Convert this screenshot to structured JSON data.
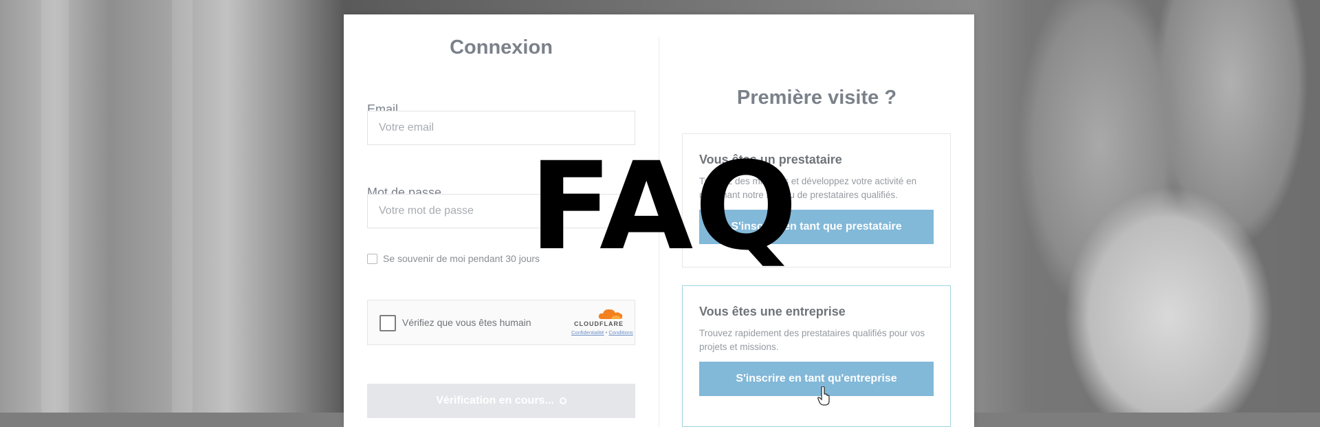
{
  "login": {
    "title": "Connexion",
    "email_label": "Email",
    "email_placeholder": "Votre email",
    "password_label": "Mot de passe",
    "password_placeholder": "Votre mot de passe",
    "remember_label": "Se souvenir de moi pendant 30 jours",
    "captcha": {
      "label": "Vérifiez que vous êtes humain",
      "brand": "CLOUDFLARE",
      "privacy_link": "Confidentialité",
      "separator": "•",
      "terms_link": "Conditions"
    },
    "submit_label": "Vérification en cours..."
  },
  "signup": {
    "title": "Première visite ?",
    "provider": {
      "title": "Vous êtes un prestataire",
      "text": "Trouvez des missions et développez votre activité en rejoignant notre réseau de prestataires qualifiés.",
      "button": "S'inscrire en tant que prestataire"
    },
    "company": {
      "title": "Vous êtes une entreprise",
      "text": "Trouvez rapidement des prestataires qualifiés pour vos projets et missions.",
      "button": "S'inscrire en tant qu'entreprise"
    }
  },
  "overlay": {
    "text": "FAQ"
  },
  "colors": {
    "primary_button": "#82b8d8",
    "disabled_button": "#e4e6ea",
    "title_text": "#7b818a",
    "active_border": "#9dd3dd",
    "cloudflare_orange": "#f48120"
  }
}
